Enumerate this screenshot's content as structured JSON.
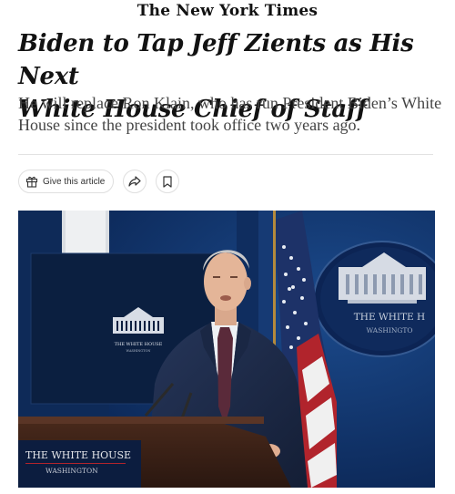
{
  "masthead": "The New York Times",
  "headline": {
    "line1": "Biden to Tap Jeff Zients as His Next",
    "line2": "White House Chief of Staff"
  },
  "summary": {
    "line1": "He will replace Ron Klain, who has run President Biden’s White",
    "line2": "House since the president took office two years ago."
  },
  "actions": {
    "gift_label": "Give this article",
    "share_icon": "share-arrow-icon",
    "bookmark_icon": "bookmark-icon"
  },
  "photo": {
    "screen_title": "THE WHITE HOUSE",
    "screen_subtitle": "WASHINGTON",
    "seal_title": "THE WHITE H",
    "seal_subtitle": "WASHINGTO",
    "podium_title": "THE WHITE HOUSE",
    "podium_subtitle": "WASHINGTON"
  },
  "colors": {
    "background_blue": "#0d2b5e",
    "suit": "#1e2d4a",
    "tie": "#5a2a3a",
    "podium": "#3b2217",
    "flag_red": "#b1242c"
  }
}
